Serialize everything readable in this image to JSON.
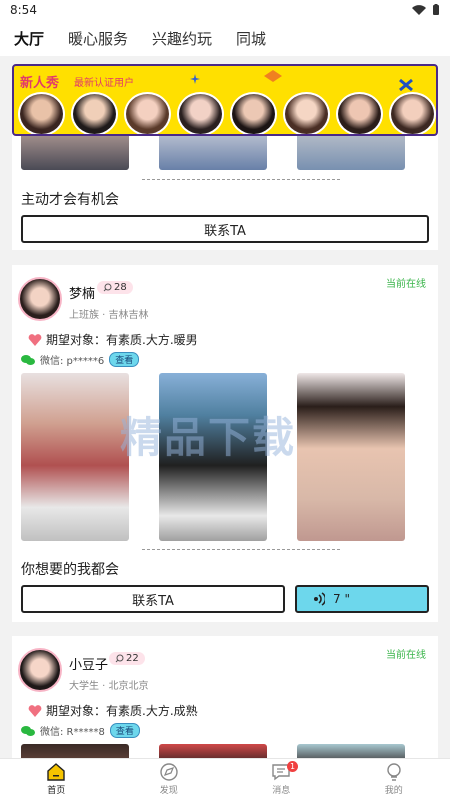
{
  "status_bar": {
    "time": "8:54"
  },
  "top_tabs": [
    {
      "label": "大厅"
    },
    {
      "label": "暖心服务"
    },
    {
      "label": "兴趣约玩"
    },
    {
      "label": "同城"
    }
  ],
  "banner": {
    "title": "新人秀",
    "subtitle": "最新认证用户"
  },
  "card0": {
    "caption": "主动才会有机会",
    "contact_label": "联系TA"
  },
  "card1": {
    "name": "梦楠",
    "age": "28",
    "meta": "上班族 · 吉林吉林",
    "online": "当前在线",
    "expect": "期望对象：有素质.大方.暖男",
    "wechat": "微信: p*****6",
    "view_label": "查看",
    "caption": "你想要的我都会",
    "contact_label": "联系TA",
    "voice_label": "7 \""
  },
  "card2": {
    "name": "小豆子",
    "age": "22",
    "meta": "大学生 · 北京北京",
    "online": "当前在线",
    "expect": "期望对象：有素质.大方.成熟",
    "wechat": "微信: R*****8",
    "view_label": "查看"
  },
  "watermark": "精品下载",
  "tab_bar": [
    {
      "label": "首页",
      "icon": "home-icon"
    },
    {
      "label": "发现",
      "icon": "discover-icon"
    },
    {
      "label": "消息",
      "icon": "message-icon",
      "badge": "1"
    },
    {
      "label": "我的",
      "icon": "profile-icon"
    }
  ],
  "colors": {
    "accent": "#f5c400",
    "online": "#3ab54a",
    "voice": "#6dd7ec",
    "banner_bg": "#ffe000"
  }
}
